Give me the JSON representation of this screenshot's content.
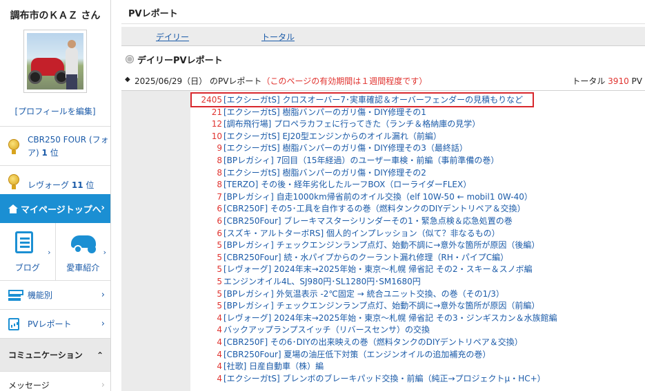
{
  "sidebar": {
    "user_name": "調布市のＫＡＺ さん",
    "profile_edit": "[プロフィールを編集]",
    "rankings": [
      {
        "label": "CBR250 FOUR (フォア)",
        "rank": "1",
        "suffix": "位"
      },
      {
        "label": "レヴォーグ",
        "rank": "11",
        "suffix": "位"
      }
    ],
    "mypage_label": "マイページトップへ",
    "blog_label": "ブログ",
    "car_label": "愛車紹介",
    "features_label": "機能別",
    "pv_label": "PVレポート",
    "community_label": "コミュニケーション",
    "message_label": "メッセージ"
  },
  "main": {
    "header": "PVレポート",
    "tabs": [
      "デイリー",
      "トータル"
    ],
    "section_title": "デイリーPVレポート",
    "report_date": "2025/06/29（日） のPVレポート",
    "notice": "（このページの有効期間は１週間程度です）",
    "total_label": "トータル",
    "total_value": "3910",
    "total_unit": "PV"
  },
  "entries": [
    {
      "count": "2405",
      "title": "[エクシーガtS] クロスオーバー7･実車確認＆オーバーフェンダーの見積もりなど",
      "highlighted": true
    },
    {
      "count": "21",
      "title": "[エクシーガtS] 樹脂バンパーのガリ傷・DIY修理その1"
    },
    {
      "count": "12",
      "title": "[調布飛行場] プロペラカフェに行ってきた（ランチ＆格納庫の見学）"
    },
    {
      "count": "10",
      "title": "[エクシーガtS] EJ20型エンジンからのオイル漏れ（前編）"
    },
    {
      "count": "9",
      "title": "[エクシーガtS] 樹脂バンパーのガリ傷・DIY修理その3（最終話）"
    },
    {
      "count": "8",
      "title": "[BPレガシィ] 7回目（15年経過）のユーザー車検・前編（事前準備の巻）"
    },
    {
      "count": "8",
      "title": "[エクシーガtS] 樹脂バンパーのガリ傷・DIY修理その2"
    },
    {
      "count": "8",
      "title": "[TERZO] その後・経年劣化したルーフBOX（ローライダーFLEX）"
    },
    {
      "count": "7",
      "title": "[BPレガシィ] 自走1000km帰省前のオイル交換（elf 10W-50 ← mobil1 0W-40）"
    },
    {
      "count": "6",
      "title": "[CBR250F] その5･工具を自作するの巻（燃料タンクのDIYデントリペア＆交換）"
    },
    {
      "count": "6",
      "title": "[CBR250Four] ブレーキマスターシリンダーその1・緊急点検＆応急処置の巻"
    },
    {
      "count": "6",
      "title": "[スズキ・アルトターボRS] 個人的インプレッション（似て？非なるもの）"
    },
    {
      "count": "5",
      "title": "[BPレガシィ] チェックエンジンランプ点灯、始動不調に→意外な箇所が原因（後編）"
    },
    {
      "count": "5",
      "title": "[CBR250Four] 続・水パイプからのクーラント漏れ修理（RH・パイプC編）"
    },
    {
      "count": "5",
      "title": "[レヴォーグ] 2024年末→2025年始・東京～札幌 帰省記 その2・スキー＆スノボ編"
    },
    {
      "count": "5",
      "title": "エンジンオイル4L、SJ980円･SL1280円･SM1680円"
    },
    {
      "count": "5",
      "title": "[BPレガシィ] 外気温表示 -2℃固定 → 統合ユニット交換、の巻（その1/3）"
    },
    {
      "count": "5",
      "title": "[BPレガシィ] チェックエンジンランプ点灯、始動不調に→意外な箇所が原因（前編）"
    },
    {
      "count": "4",
      "title": "[レヴォーグ] 2024年末→2025年始・東京～札幌 帰省記 その3・ジンギスカン＆水族館編"
    },
    {
      "count": "4",
      "title": "バックアップランプスイッチ（リバースセンサ）の交換"
    },
    {
      "count": "4",
      "title": "[CBR250F] その6･DIYの出来映えの巻（燃料タンクのDIYデントリペア＆交換）"
    },
    {
      "count": "4",
      "title": "[CBR250Four] 夏場の油圧低下対策（エンジンオイルの追加補充の巻）"
    },
    {
      "count": "4",
      "title": "[社歌] 日産自動車（株）編"
    },
    {
      "count": "4",
      "title": "[エクシーガtS] ブレンボのブレーキパッド交換・前編（純正→プロジェクトμ・HC+）"
    }
  ]
}
